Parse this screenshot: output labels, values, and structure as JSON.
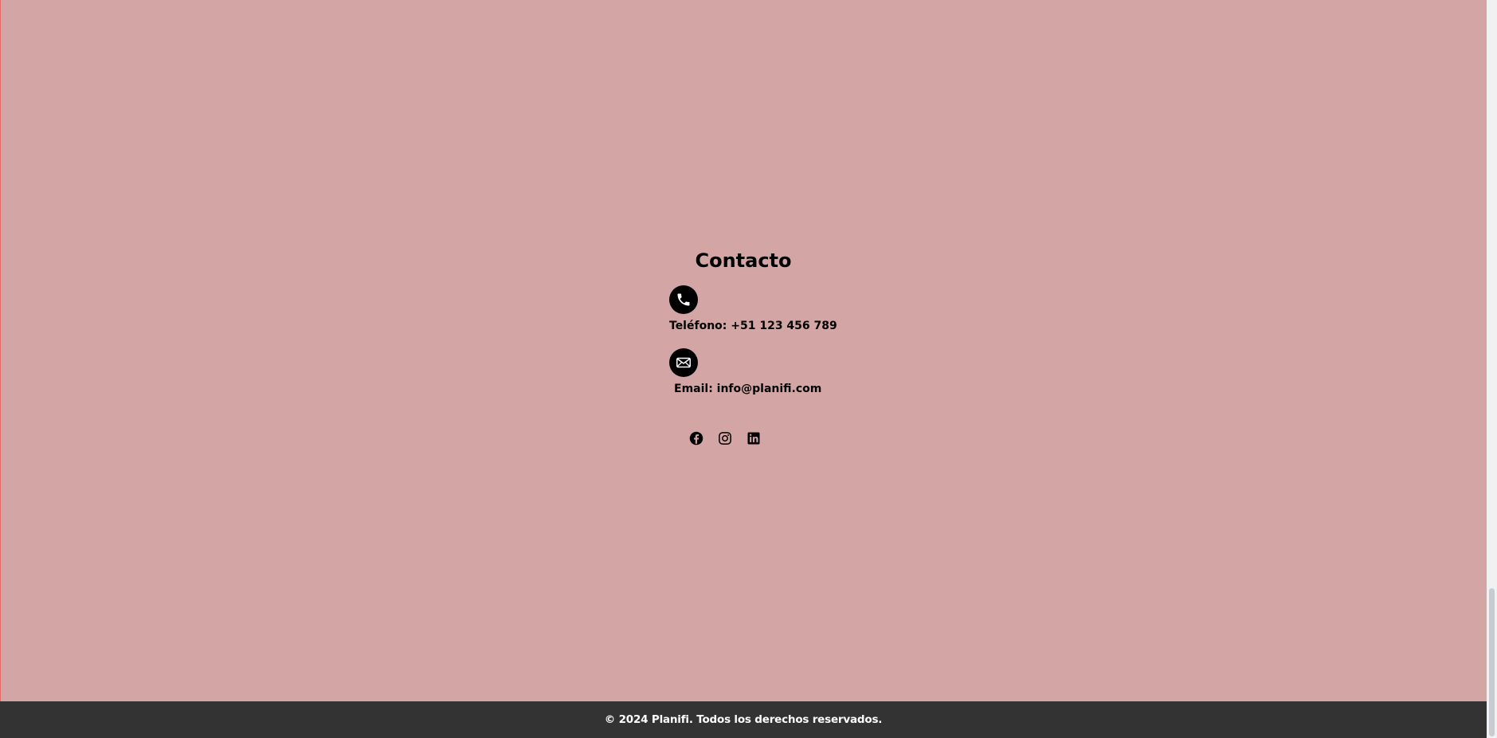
{
  "contact": {
    "title": "Contacto",
    "phone": {
      "icon": "phone-icon",
      "text": "Teléfono: +51 123 456 789"
    },
    "email": {
      "icon": "mail-icon",
      "text": "Email: info@planifi.com"
    },
    "socials": [
      {
        "icon": "facebook-icon"
      },
      {
        "icon": "instagram-icon"
      },
      {
        "icon": "linkedin-icon"
      }
    ]
  },
  "footer": {
    "text": "© 2024 Planifi. Todos los derechos reservados."
  },
  "colors": {
    "background": "#d4a5a5",
    "footer_background": "#333333",
    "text": "#000000",
    "footer_text": "#ffffff"
  }
}
